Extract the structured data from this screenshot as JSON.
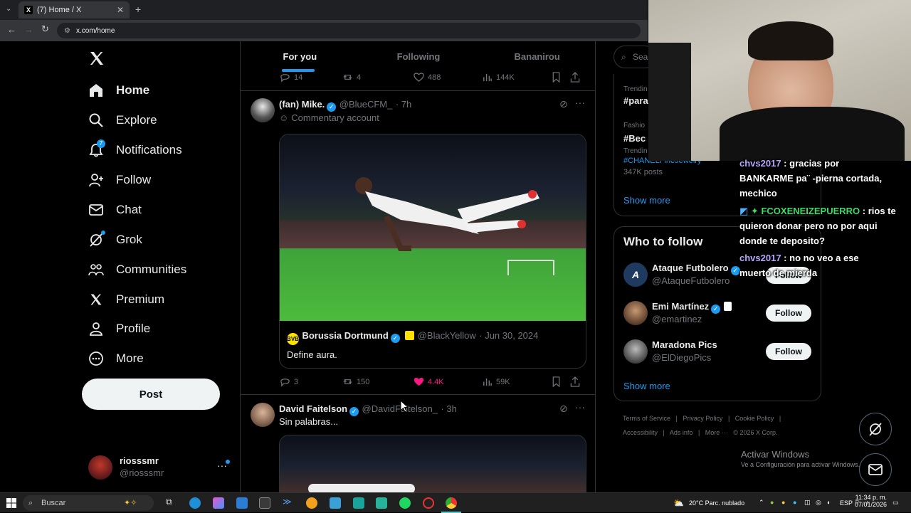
{
  "browser": {
    "tab_title": "(7) Home / X",
    "url": "x.com/home"
  },
  "sidebar": {
    "items": [
      {
        "label": "Home",
        "icon": "home-icon"
      },
      {
        "label": "Explore",
        "icon": "search-icon"
      },
      {
        "label": "Notifications",
        "icon": "bell-icon"
      },
      {
        "label": "Follow",
        "icon": "person-add-icon"
      },
      {
        "label": "Chat",
        "icon": "mail-icon"
      },
      {
        "label": "Grok",
        "icon": "grok-icon"
      },
      {
        "label": "Communities",
        "icon": "communities-icon"
      },
      {
        "label": "Premium",
        "icon": "x-logo-icon"
      },
      {
        "label": "Profile",
        "icon": "person-icon"
      },
      {
        "label": "More",
        "icon": "more-circle-icon"
      }
    ],
    "post_label": "Post",
    "account": {
      "name": "riosssmr",
      "handle": "@riosssmr"
    }
  },
  "feed": {
    "tabs": [
      "For you",
      "Following",
      "Bananirou"
    ],
    "top_actions": {
      "replies": "14",
      "reposts": "4",
      "likes": "488",
      "views": "144K"
    },
    "post1": {
      "name": "(fan) Mike.",
      "handle": "@BlueCFM_",
      "time": "· 7h",
      "label": "Commentary account",
      "quote": {
        "name": "Borussia Dortmund",
        "handle": "@BlackYellow",
        "time": "· Jun 30, 2024",
        "text": "Define aura."
      },
      "actions": {
        "replies": "3",
        "reposts": "150",
        "likes": "4.4K",
        "views": "59K"
      }
    },
    "post2": {
      "name": "David Faitelson",
      "handle": "@DavidFaitelson_",
      "time": "· 3h",
      "text": "Sin palabras..."
    }
  },
  "right": {
    "search_placeholder": "Sea",
    "trends": [
      {
        "meta": "Trendin",
        "name": "#para"
      },
      {
        "meta": "Fashio",
        "name": "#Bec"
      },
      {
        "meta": "Trendin",
        "name": "#CHANELFineJewelry",
        "posts": "347K posts"
      }
    ],
    "show_more": "Show more",
    "who_to_follow": {
      "title": "Who to follow",
      "users": [
        {
          "name": "Ataque Futbolero",
          "handle": "@AtaqueFutbolero",
          "button": "Follow"
        },
        {
          "name": "Emi Martínez",
          "handle": "@emartinez",
          "button": "Follow"
        },
        {
          "name": "Maradona Pics",
          "handle": "@ElDiegoPics",
          "button": "Follow"
        }
      ],
      "show_more": "Show more"
    },
    "footer": {
      "line1": [
        "Terms of Service",
        "|",
        "Privacy Policy",
        "|",
        "Cookie Policy",
        "|"
      ],
      "line2": [
        "Accessibility",
        "|",
        "Ads info",
        "|",
        "More ···",
        "© 2026 X Corp."
      ]
    },
    "windows_watermark": {
      "title": "Activar Windows",
      "subtitle": "Ve a Configuración para activar Windows."
    }
  },
  "chat": [
    {
      "user": "chvs2017",
      "sep": " : ",
      "text": " gracias por",
      "line2": "BANKARME pa¨ -pierna cortada,",
      "line3": "mechico"
    },
    {
      "user": "FCOXENEIZEPUERRO",
      "sep": " : ",
      "text": "rios te",
      "line2": "quieron donar pero no por aqui",
      "line3": "donde te deposito?"
    },
    {
      "user": "chvs2017",
      "sep": " : ",
      "text": "no no veo a ese",
      "line2": "muerto de mierda"
    }
  ],
  "taskbar": {
    "search_placeholder": "Buscar",
    "weather": "20°C  Parc. nublado",
    "lang": "ESP",
    "time": "11:34 p. m.",
    "date": "07/01/2026"
  },
  "colors": {
    "accent": "#1d9bf0",
    "like": "#f91880",
    "bg": "#000000"
  }
}
